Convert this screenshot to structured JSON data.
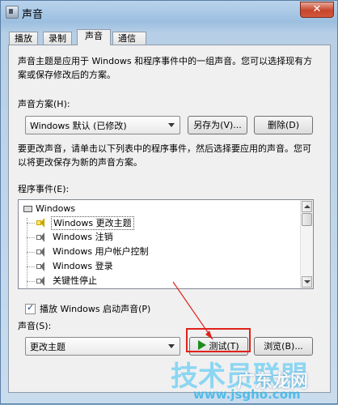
{
  "window": {
    "title": "声音",
    "close_label": "✕"
  },
  "tabs": [
    {
      "label": "播放",
      "active": false
    },
    {
      "label": "录制",
      "active": false
    },
    {
      "label": "声音",
      "active": true
    },
    {
      "label": "通信",
      "active": false
    }
  ],
  "intro_text_1": "声音主题是应用于 Windows 和程序事件中的一组声音。您可以选择现有方",
  "intro_text_2": "案或保存修改后的方案。",
  "scheme": {
    "label": "声音方案(H):",
    "value": "Windows 默认 (已修改)",
    "save_as_label": "另存为(V)...",
    "delete_label": "删除(D)"
  },
  "change_text_1": "要更改声音，请单击以下列表中的程序事件，然后选择要应用的声音。您可",
  "change_text_2": "以将更改保存为新的声音方案。",
  "events": {
    "label": "程序事件(E):",
    "group": "Windows",
    "items": [
      {
        "label": "Windows 更改主题",
        "selected": true
      },
      {
        "label": "Windows 注销",
        "selected": false
      },
      {
        "label": "Windows 用户帐户控制",
        "selected": false
      },
      {
        "label": "Windows 登录",
        "selected": false
      },
      {
        "label": "关键性停止",
        "selected": false
      }
    ]
  },
  "startup_sound": {
    "label": "播放 Windows 启动声音(P)",
    "checked": true
  },
  "sound": {
    "label": "声音(S):",
    "value": "更改主题",
    "test_label": "测试(T)",
    "browse_label": "浏览(B)..."
  },
  "watermark": {
    "left_text": "技术员联盟",
    "right_text": "广东龙网",
    "url": "www.jsgho.com"
  },
  "colors": {
    "annotation_red": "#e0221b",
    "watermark": "#7bd2f3"
  }
}
